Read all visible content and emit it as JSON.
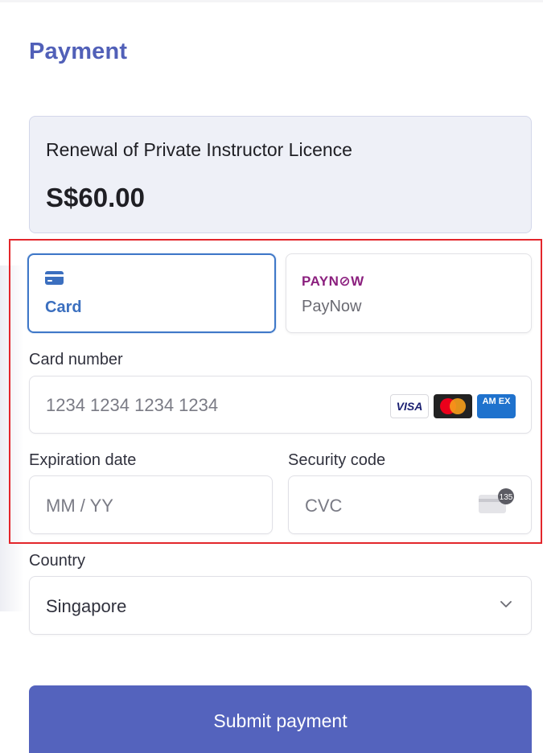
{
  "header": {
    "title": "Payment"
  },
  "summary": {
    "description": "Renewal of Private Instructor Licence",
    "amount": "S$60.00"
  },
  "payment_methods": {
    "card": {
      "label": "Card",
      "icon": "credit-card-icon",
      "accent": "#3b6fbf",
      "selected": true
    },
    "paynow": {
      "logo_text": "PAYN⊘W",
      "label": "PayNow",
      "logo_color": "#8b1f7e",
      "selected": false
    }
  },
  "card_number": {
    "label": "Card number",
    "placeholder": "1234 1234 1234 1234",
    "brands": {
      "visa": "VISA",
      "mastercard": "mastercard-icon",
      "amex": "AM EX"
    }
  },
  "expiration": {
    "label": "Expiration date",
    "placeholder": "MM / YY"
  },
  "security_code": {
    "label": "Security code",
    "placeholder": "CVC",
    "icon_badge": "135"
  },
  "country": {
    "label": "Country",
    "value": "Singapore",
    "icon": "chevron-down-icon"
  },
  "submit": {
    "label": "Submit payment",
    "color": "#5463bd"
  },
  "colors": {
    "heading": "#5160b8",
    "highlight_border": "#e3262b",
    "summary_bg": "#eef0f7"
  }
}
